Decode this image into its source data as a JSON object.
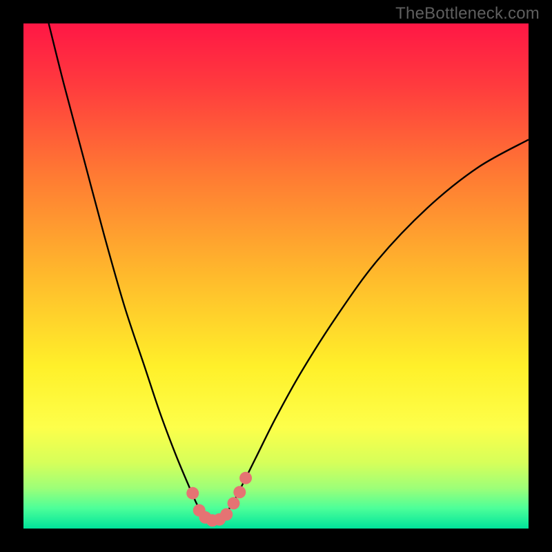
{
  "watermark": {
    "text": "TheBottleneck.com"
  },
  "chart_data": {
    "type": "line",
    "title": "",
    "xlabel": "",
    "ylabel": "",
    "xlim": [
      0,
      100
    ],
    "ylim": [
      0,
      100
    ],
    "grid": false,
    "legend": false,
    "gradient_stops": [
      {
        "offset": 0.0,
        "color": "#ff1745"
      },
      {
        "offset": 0.12,
        "color": "#ff3a3e"
      },
      {
        "offset": 0.3,
        "color": "#ff7a33"
      },
      {
        "offset": 0.5,
        "color": "#ffba2c"
      },
      {
        "offset": 0.68,
        "color": "#fff02a"
      },
      {
        "offset": 0.8,
        "color": "#fdff4a"
      },
      {
        "offset": 0.87,
        "color": "#d6ff5a"
      },
      {
        "offset": 0.92,
        "color": "#9dff78"
      },
      {
        "offset": 0.96,
        "color": "#4cff99"
      },
      {
        "offset": 1.0,
        "color": "#00e39a"
      }
    ],
    "series": [
      {
        "name": "bottleneck-curve",
        "color": "#000000",
        "x": [
          5,
          8,
          12,
          16,
          20,
          24,
          27,
          30,
          32.5,
          34.5,
          36,
          37.5,
          39,
          41,
          43,
          46,
          50,
          55,
          62,
          70,
          80,
          90,
          100
        ],
        "y": [
          100,
          88,
          73,
          58,
          44,
          32,
          23,
          15,
          9,
          4.5,
          2.3,
          1.5,
          2.2,
          4.3,
          8,
          14,
          22,
          31,
          42,
          53,
          63.5,
          71.5,
          77
        ]
      }
    ],
    "markers": {
      "name": "sweet-spot-markers",
      "color": "#e57373",
      "radius_px": 9,
      "points": [
        {
          "x": 33.5,
          "y": 7.0
        },
        {
          "x": 34.8,
          "y": 3.6
        },
        {
          "x": 36.0,
          "y": 2.2
        },
        {
          "x": 37.4,
          "y": 1.6
        },
        {
          "x": 38.8,
          "y": 1.8
        },
        {
          "x": 40.2,
          "y": 2.8
        },
        {
          "x": 41.6,
          "y": 5.0
        },
        {
          "x": 42.8,
          "y": 7.2
        },
        {
          "x": 44.0,
          "y": 10.0
        }
      ]
    }
  }
}
